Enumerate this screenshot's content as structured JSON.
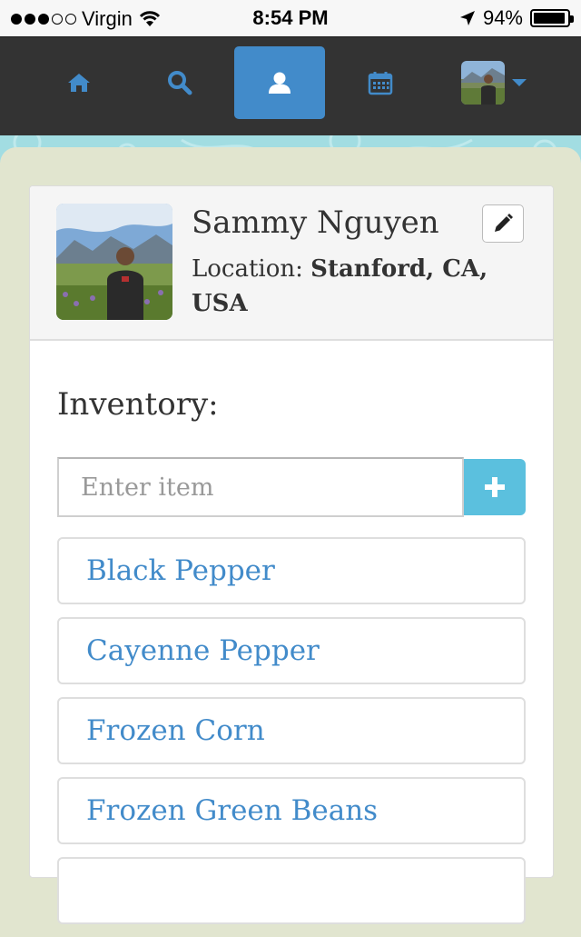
{
  "status_bar": {
    "carrier": "Virgin",
    "time": "8:54 PM",
    "battery": "94%",
    "battery_level": 0.94,
    "signal_bars_filled": 3,
    "signal_bars_total": 5
  },
  "navbar": {
    "items": [
      {
        "icon": "home-icon",
        "active": false
      },
      {
        "icon": "search-icon",
        "active": false
      },
      {
        "icon": "user-icon",
        "active": true
      },
      {
        "icon": "calendar-icon",
        "active": false
      },
      {
        "icon": "avatar-dropdown",
        "active": false
      }
    ],
    "active_color": "#428bca",
    "icon_color": "#428bca"
  },
  "profile": {
    "name": "Sammy Nguyen",
    "location_label": "Location:",
    "location_value": "Stanford, CA, USA"
  },
  "inventory": {
    "title": "Inventory:",
    "input_placeholder": "Enter item",
    "add_label": "+",
    "items": [
      {
        "label": "Black Pepper"
      },
      {
        "label": "Cayenne Pepper"
      },
      {
        "label": "Frozen Corn"
      },
      {
        "label": "Frozen Green Beans"
      },
      {
        "label": ""
      }
    ]
  },
  "colors": {
    "link": "#428bca",
    "add_button": "#5bc0de",
    "navbar": "#333333",
    "page_bg": "#e1e5cf"
  }
}
